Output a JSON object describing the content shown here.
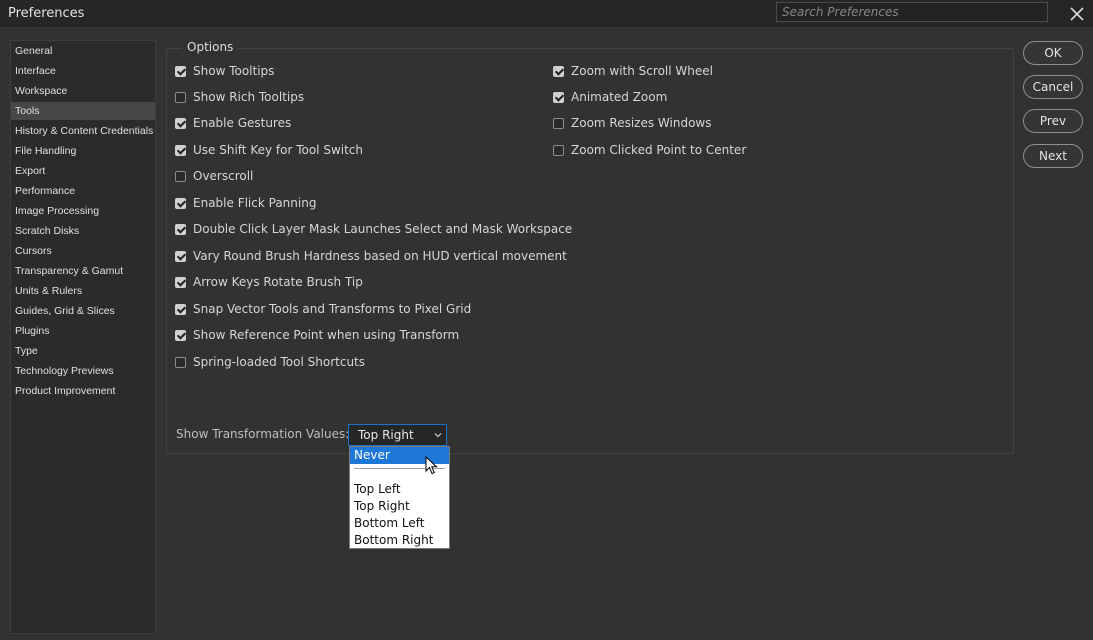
{
  "window": {
    "title": "Preferences"
  },
  "search": {
    "placeholder": "Search Preferences",
    "icon": "close-icon"
  },
  "sidebar": {
    "items": [
      {
        "label": "General"
      },
      {
        "label": "Interface"
      },
      {
        "label": "Workspace"
      },
      {
        "label": "Tools",
        "selected": true
      },
      {
        "label": "History & Content Credentials"
      },
      {
        "label": "File Handling"
      },
      {
        "label": "Export"
      },
      {
        "label": "Performance"
      },
      {
        "label": "Image Processing"
      },
      {
        "label": "Scratch Disks"
      },
      {
        "label": "Cursors"
      },
      {
        "label": "Transparency & Gamut"
      },
      {
        "label": "Units & Rulers"
      },
      {
        "label": "Guides, Grid & Slices"
      },
      {
        "label": "Plugins"
      },
      {
        "label": "Type"
      },
      {
        "label": "Technology Previews"
      },
      {
        "label": "Product Improvement"
      }
    ]
  },
  "options": {
    "legend": "Options",
    "left": [
      {
        "label": "Show Tooltips",
        "checked": true
      },
      {
        "label": "Show Rich Tooltips",
        "checked": false
      },
      {
        "label": "Enable Gestures",
        "checked": true
      },
      {
        "label": "Use Shift Key for Tool Switch",
        "checked": true
      },
      {
        "label": "Overscroll",
        "checked": false
      },
      {
        "label": "Enable Flick Panning",
        "checked": true
      },
      {
        "label": "Double Click Layer Mask Launches Select and Mask Workspace",
        "checked": true
      },
      {
        "label": "Vary Round Brush Hardness based on HUD vertical movement",
        "checked": true
      },
      {
        "label": "Arrow Keys Rotate Brush Tip",
        "checked": true
      },
      {
        "label": "Snap Vector Tools and Transforms to Pixel Grid",
        "checked": true
      },
      {
        "label": "Show Reference Point when using Transform",
        "checked": true
      },
      {
        "label": "Spring-loaded Tool Shortcuts",
        "checked": false
      }
    ],
    "right": [
      {
        "label": "Zoom with Scroll Wheel",
        "checked": true
      },
      {
        "label": "Animated Zoom",
        "checked": true
      },
      {
        "label": "Zoom Resizes Windows",
        "checked": false
      },
      {
        "label": "Zoom Clicked Point to Center",
        "checked": false
      }
    ]
  },
  "transform_values": {
    "label": "Show Transformation Values:",
    "selected": "Top Right",
    "options": [
      "Never",
      "Top Left",
      "Top Right",
      "Bottom Left",
      "Bottom Right"
    ],
    "highlighted": "Never"
  },
  "buttons": {
    "ok": "OK",
    "cancel": "Cancel",
    "prev": "Prev",
    "next": "Next"
  },
  "colors": {
    "background": "#323232",
    "titlebar": "#262626",
    "accent": "#1e78d8",
    "selected_item": "#474747"
  }
}
